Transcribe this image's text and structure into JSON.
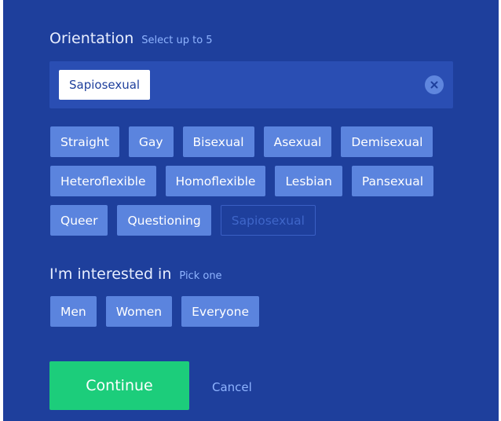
{
  "orientation": {
    "title": "Orientation",
    "hint": "Select up to 5",
    "selected": [
      "Sapiosexual"
    ],
    "options_row1": [
      "Straight",
      "Gay",
      "Bisexual",
      "Asexual",
      "Demisexual"
    ],
    "options_row2": [
      "Heteroflexible",
      "Homoflexible",
      "Lesbian",
      "Pansexual"
    ],
    "options_row3": [
      "Queer",
      "Questioning",
      "Sapiosexual"
    ]
  },
  "interest": {
    "title": "I'm interested in",
    "hint": "Pick one",
    "options": [
      "Men",
      "Women",
      "Everyone"
    ]
  },
  "actions": {
    "continue_label": "Continue",
    "cancel_label": "Cancel"
  },
  "icons": {
    "clear": "close-icon"
  },
  "colors": {
    "background": "#1e3f9c",
    "chip": "#5b84de",
    "selected_box": "#2a4eb3",
    "continue": "#1ccd7b",
    "hint": "#8fb4ff"
  }
}
